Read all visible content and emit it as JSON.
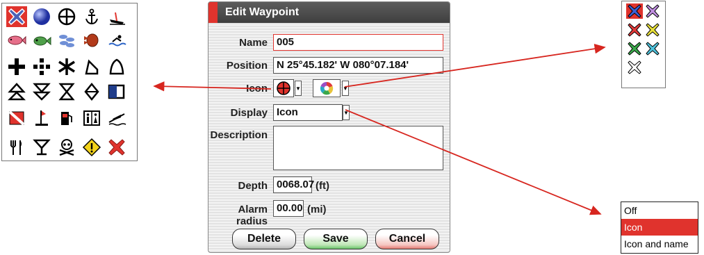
{
  "dialog": {
    "title": "Edit Waypoint",
    "fields": {
      "name_label": "Name",
      "name_value": "005",
      "position_label": "Position",
      "position_value": "N 25°45.182'  W 080°07.184'",
      "icon_label": "Icon",
      "display_label": "Display",
      "display_value": "Icon",
      "description_label": "Description",
      "description_value": "",
      "depth_label": "Depth",
      "depth_value": "0068.07",
      "depth_unit": "(ft)",
      "alarm_label": "Alarm radius",
      "alarm_value": "00.00",
      "alarm_unit": "(mi)"
    },
    "buttons": {
      "delete": "Delete",
      "save": "Save",
      "cancel": "Cancel"
    }
  },
  "display_options": {
    "items": [
      "Off",
      "Icon",
      "Icon and name"
    ],
    "selected": "Icon"
  },
  "icon_palette": {
    "selected": "x-mark-blue",
    "rows": [
      [
        "x-mark-blue-icon",
        "sphere-icon",
        "crosshair-icon",
        "anchor-icon",
        "wreck-icon"
      ],
      [
        "fish-icon",
        "fish-school-icon",
        "fish-school-small-icon",
        "lobster-icon",
        "swimmer-icon"
      ],
      [
        "cross-icon",
        "dashed-cross-icon",
        "star-burst-icon",
        "buoy-icon",
        "bell-buoy-icon"
      ],
      [
        "triangle-up-icon",
        "triangle-down-icon",
        "hourglass-icon",
        "diamond-icon",
        "flag-icon"
      ],
      [
        "dive-flag-icon",
        "beacon-icon",
        "fuel-icon",
        "restroom-icon",
        "boat-ramp-icon"
      ],
      [
        "restaurant-icon",
        "cocktail-icon",
        "skull-icon",
        "warning-icon",
        "x-mark-red-icon"
      ]
    ]
  },
  "color_palette": {
    "selected": "blue",
    "colors": [
      "#3a5fd6",
      "#9b4fc4",
      "#e03a3a",
      "#d4c816",
      "#3aa84a",
      "#27a8c4",
      "#ffffff"
    ]
  }
}
